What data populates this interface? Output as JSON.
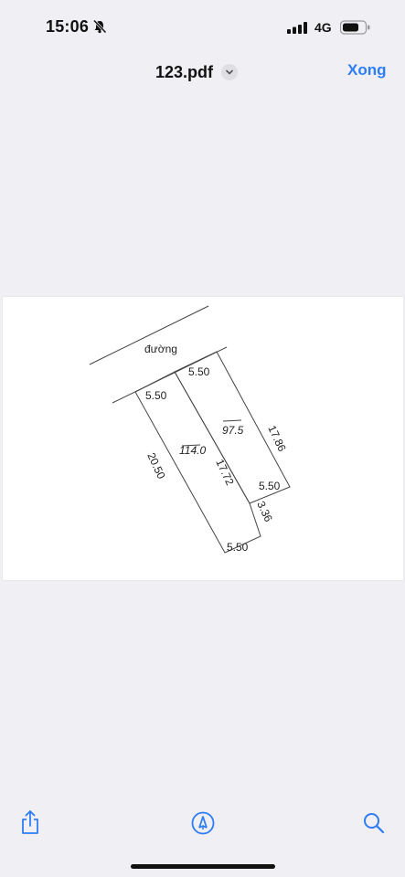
{
  "status_bar": {
    "time": "15:06",
    "network": "4G",
    "icons": [
      "bell-slash-icon",
      "signal-icon",
      "battery-icon"
    ]
  },
  "nav_bar": {
    "title": "123.pdf",
    "done_label": "Xong",
    "title_menu_icon": "chevron-down-icon"
  },
  "document": {
    "plan_labels": {
      "road": "đường",
      "lot_a_front": "5.50",
      "lot_b_front": "5.50",
      "lot_a_left": "20.50",
      "lot_a_area": "114.0",
      "shared_side": "17.72",
      "lot_b_area": "97.5",
      "lot_b_right": "17.86",
      "lot_b_back": "5.50",
      "step_side": "3.36",
      "lot_a_back": "5.50"
    }
  },
  "toolbar": {
    "icons": [
      "share-icon",
      "markup-icon",
      "search-icon"
    ]
  },
  "theme": {
    "accent": "#2f7df6",
    "background": "#efeff4"
  }
}
